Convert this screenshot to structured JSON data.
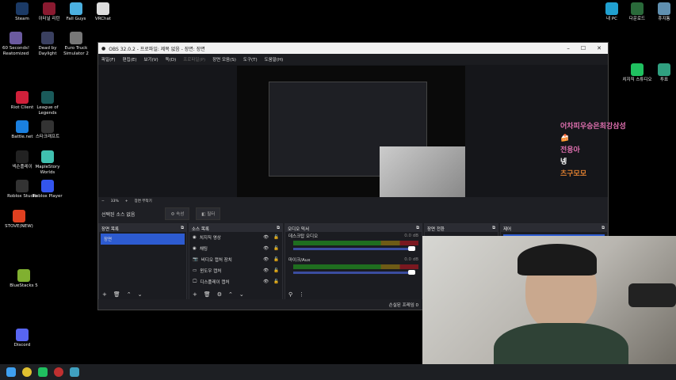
{
  "desktop": {
    "icons": [
      {
        "label": "Steam",
        "color": "#1b3a66"
      },
      {
        "label": "이터널 리턴",
        "color": "#8a1a30"
      },
      {
        "label": "Fall Guys",
        "color": "#4bb0e0"
      },
      {
        "label": "VRChat",
        "color": "#ddd"
      },
      {
        "label": "60 Seconds! Reatomized",
        "color": "#6b5aa0"
      },
      {
        "label": "Dead by Daylight",
        "color": "#3a4060"
      },
      {
        "label": "Euro Truck Simulator 2",
        "color": "#777"
      },
      {
        "label": "Riot Client",
        "color": "#d0203a"
      },
      {
        "label": "League of Legends",
        "color": "#1a5a5a"
      },
      {
        "label": "Battle.net",
        "color": "#1a80e0"
      },
      {
        "label": "스타크래프트",
        "color": "#333"
      },
      {
        "label": "넥슨플레이",
        "color": "#222"
      },
      {
        "label": "MapleStory Worlds",
        "color": "#40c0b0"
      },
      {
        "label": "Roblox Studio",
        "color": "#333"
      },
      {
        "label": "Roblox Player",
        "color": "#3355ee"
      },
      {
        "label": "STOVE(NEW)",
        "color": "#e04020"
      },
      {
        "label": "BlueStacks 5",
        "color": "#80b030"
      },
      {
        "label": "Discord",
        "color": "#5865f2"
      },
      {
        "label": "내 PC",
        "color": "#20a0d0"
      },
      {
        "label": "다운로드",
        "color": "#2a6a3a"
      },
      {
        "label": "휴지통",
        "color": "#6090b0"
      },
      {
        "label": "치지직 스튜디오",
        "color": "#20c060"
      },
      {
        "label": "투표",
        "color": "#30a080"
      }
    ]
  },
  "obs": {
    "title": "OBS 32.0.2 - 프로파일: 제목 없음 - 장면: 장면",
    "window_controls": [
      "–",
      "☐",
      "✕"
    ],
    "menu": [
      "파일(F)",
      "편집(E)",
      "보기(V)",
      "독(D)",
      "프로파일(P)",
      "장면 모음(S)",
      "도구(T)",
      "도움말(H)"
    ],
    "zoom": "33%",
    "zoom_label": "장면 부착기",
    "no_source": "선택된 소스 없음",
    "properties_btn": "⚙ 속성",
    "filters_btn": "◧ 필터",
    "scenes": {
      "title": "장면 목록",
      "items": [
        "장면"
      ]
    },
    "sources": {
      "title": "소스 목록",
      "items": [
        {
          "icon": "◉",
          "label": "치지직 영상"
        },
        {
          "icon": "◉",
          "label": "채팅"
        },
        {
          "icon": "📷",
          "label": "비디오 캡처 장치"
        },
        {
          "icon": "▭",
          "label": "윈도우 캡처"
        },
        {
          "icon": "🖵",
          "label": "디스플레이 캡처"
        }
      ]
    },
    "mixer": {
      "title": "오디오 믹서",
      "channels": [
        {
          "name": "데스크탑 오디오",
          "db": "0.0 dB"
        },
        {
          "name": "마이크/Aux",
          "db": "0.0 dB"
        }
      ]
    },
    "transitions": {
      "title": "장면 전환"
    },
    "controls": {
      "title": "제어"
    },
    "status": "손실된 프레임 0"
  },
  "chat": {
    "messages": [
      {
        "text": "어차피우승은최강삼성",
        "color": "#e070b0"
      },
      {
        "text": "전용아",
        "color": "#e070b0"
      },
      {
        "text": "넹",
        "color": "#ffffff"
      },
      {
        "text": "츠구모모",
        "color": "#e08030"
      }
    ]
  }
}
